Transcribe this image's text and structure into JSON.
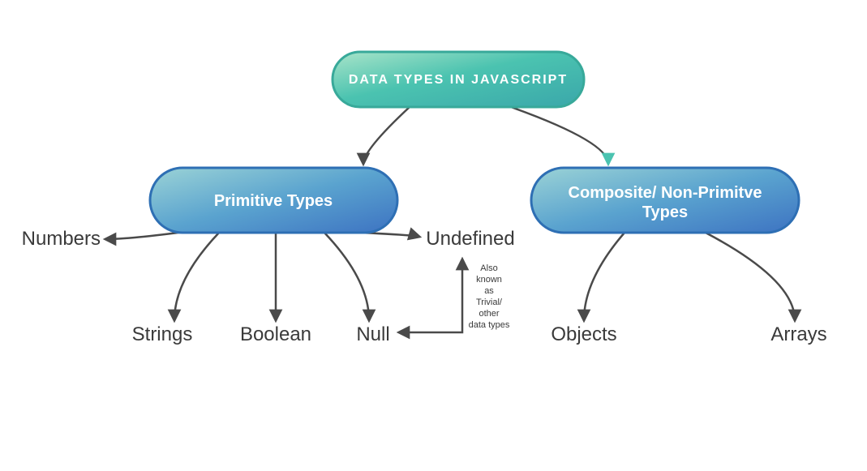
{
  "root": {
    "label": "DATA TYPES IN JAVASCRIPT"
  },
  "branches": {
    "primitive": {
      "label": "Primitive Types"
    },
    "composite": {
      "label_line1": "Composite/ Non-Primitve",
      "label_line2": "Types"
    }
  },
  "leaves": {
    "numbers": "Numbers",
    "strings": "Strings",
    "boolean": "Boolean",
    "null": "Null",
    "undefined": "Undefined",
    "objects": "Objects",
    "arrays": "Arrays"
  },
  "note": {
    "line1": "Also",
    "line2": "known",
    "line3": "as",
    "line4": "Trivial/",
    "line5": "other",
    "line6": "data types"
  }
}
